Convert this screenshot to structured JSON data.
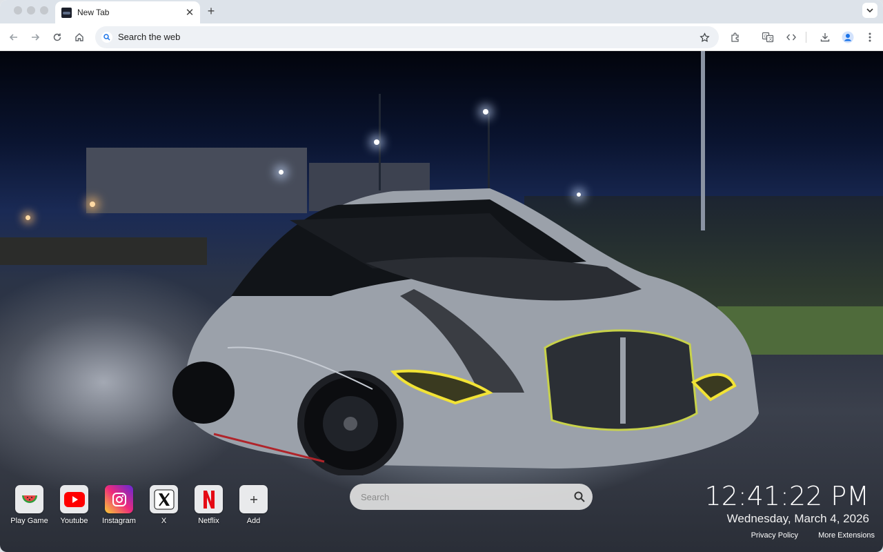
{
  "browser": {
    "tab_title": "New Tab",
    "omnibox_placeholder": "Search the web"
  },
  "shortcuts": [
    {
      "label": "Play Game",
      "icon": "watermelon-icon"
    },
    {
      "label": "Youtube",
      "icon": "youtube-icon"
    },
    {
      "label": "Instagram",
      "icon": "instagram-icon"
    },
    {
      "label": "X",
      "icon": "x-icon"
    },
    {
      "label": "Netflix",
      "icon": "netflix-icon"
    },
    {
      "label": "Add",
      "icon": "plus-icon"
    }
  ],
  "search": {
    "placeholder": "Search"
  },
  "clock": {
    "time": "12:41:22 PM",
    "date": "Wednesday, March 4, 2026"
  },
  "footer_links": {
    "privacy": "Privacy Policy",
    "extensions": "More Extensions"
  },
  "colors": {
    "accent_red": "#e50914",
    "youtube_red": "#ff0000",
    "tab_strip": "#dde3ea"
  }
}
